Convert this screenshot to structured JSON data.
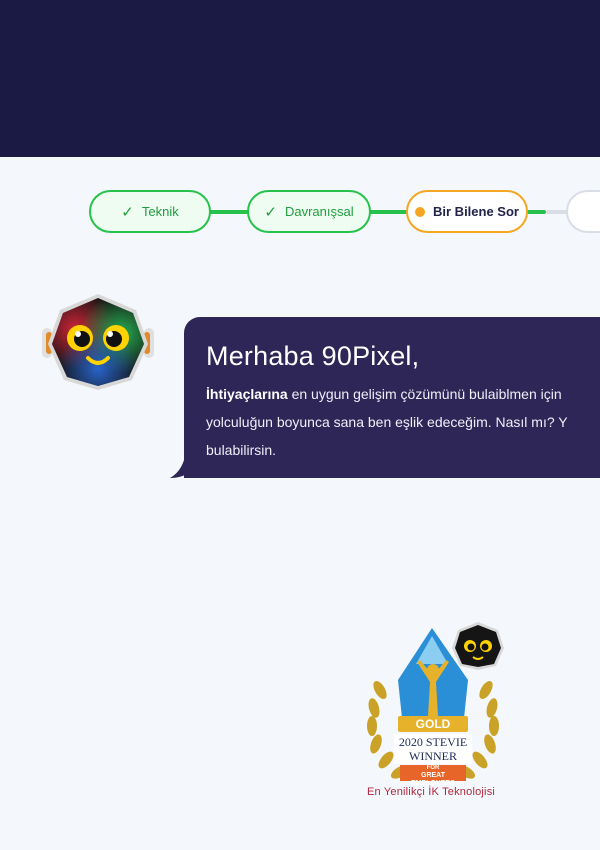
{
  "stepper": {
    "steps": [
      {
        "label": "Teknik",
        "state": "done"
      },
      {
        "label": "Davranışsal",
        "state": "done"
      },
      {
        "label": "Bir Bilene Sor",
        "state": "active"
      },
      {
        "label": "",
        "state": "pending"
      }
    ]
  },
  "chat": {
    "greeting": "Merhaba 90Pixel,",
    "line1_bold": "İhtiyaçlarına",
    "line1_rest": " en uygun gelişim çözümünü bulaiblmen için",
    "line2": "yolculuğun boyunca sana ben eşlik edeceğim. Nasıl mı? Y",
    "line3": "bulabilirsin."
  },
  "award": {
    "badge_gold": "GOLD",
    "badge_year": "2020 STEVIE",
    "badge_winner": "WINNER",
    "badge_for": "FOR",
    "badge_great": "GREAT EMPLOYERS",
    "caption": "En Yenilikçi İK Teknolojisi"
  },
  "colors": {
    "header": "#1a1a45",
    "background": "#f4f7fb",
    "success": "#27c24c",
    "active": "#f5a623",
    "bubble": "#2e2657",
    "caption": "#b0283c"
  },
  "icons": {
    "step_done": "check-icon",
    "step_active": "dot-icon",
    "assistant": "robot-avatar-icon",
    "award": "stevie-award-icon"
  }
}
